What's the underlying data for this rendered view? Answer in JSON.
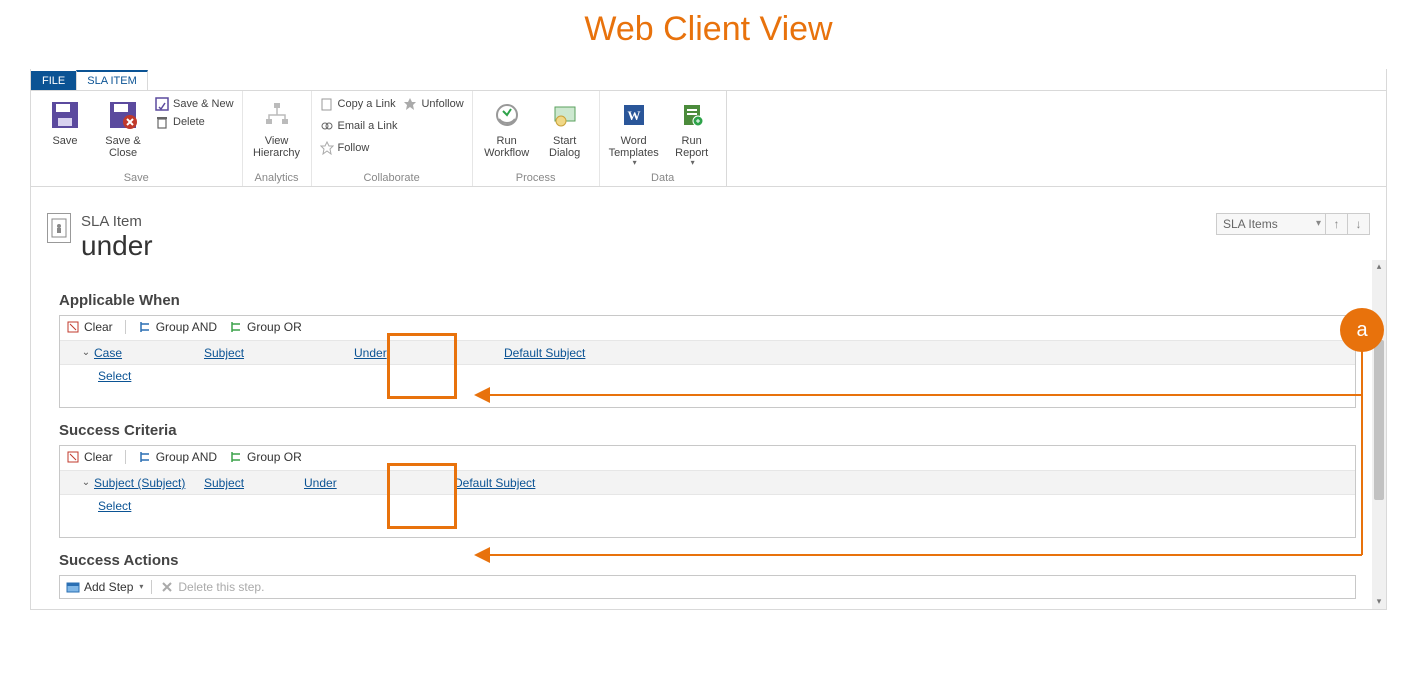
{
  "page_heading": "Web Client View",
  "tabs": {
    "file": "FILE",
    "sla_item": "SLA ITEM"
  },
  "ribbon": {
    "save_group": {
      "label": "Save",
      "save": "Save",
      "save_close": "Save &\nClose",
      "save_new": "Save & New",
      "delete": "Delete"
    },
    "analytics_group": {
      "label": "Analytics",
      "view_hierarchy": "View\nHierarchy"
    },
    "collaborate_group": {
      "label": "Collaborate",
      "copy_link": "Copy a Link",
      "email_link": "Email a Link",
      "follow": "Follow",
      "unfollow": "Unfollow"
    },
    "process_group": {
      "label": "Process",
      "run_workflow": "Run\nWorkflow",
      "start_dialog": "Start\nDialog"
    },
    "data_group": {
      "label": "Data",
      "word_templates": "Word\nTemplates",
      "run_report": "Run\nReport"
    }
  },
  "record": {
    "entity": "SLA Item",
    "name": "under",
    "nav_select": "SLA Items"
  },
  "sections": {
    "applicable_when": {
      "title": "Applicable When",
      "toolbar": {
        "clear": "Clear",
        "group_and": "Group AND",
        "group_or": "Group OR"
      },
      "row": {
        "entity": "Case",
        "field": "Subject",
        "operator": "Under",
        "value": "Default Subject"
      },
      "select": "Select"
    },
    "success_criteria": {
      "title": "Success Criteria",
      "toolbar": {
        "clear": "Clear",
        "group_and": "Group AND",
        "group_or": "Group OR"
      },
      "row": {
        "entity": "Subject (Subject)",
        "field": "Subject",
        "operator": "Under",
        "value": "Default Subject"
      },
      "select": "Select"
    },
    "success_actions": {
      "title": "Success Actions",
      "add_step": "Add Step",
      "delete_step": "Delete this step."
    }
  },
  "annotation": {
    "label": "a"
  }
}
